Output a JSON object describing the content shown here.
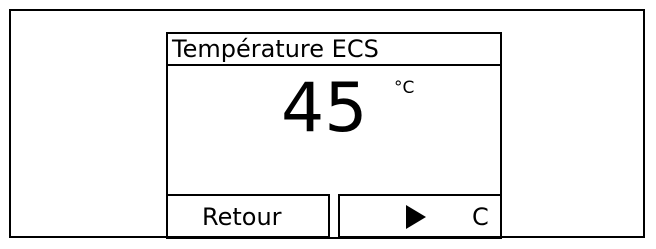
{
  "screen": {
    "title": "Température ECS",
    "value": "45",
    "unit": "°C"
  },
  "softkeys": {
    "left_label": "Retour",
    "right_icon": "play-arrow-icon",
    "right_label": "C"
  }
}
